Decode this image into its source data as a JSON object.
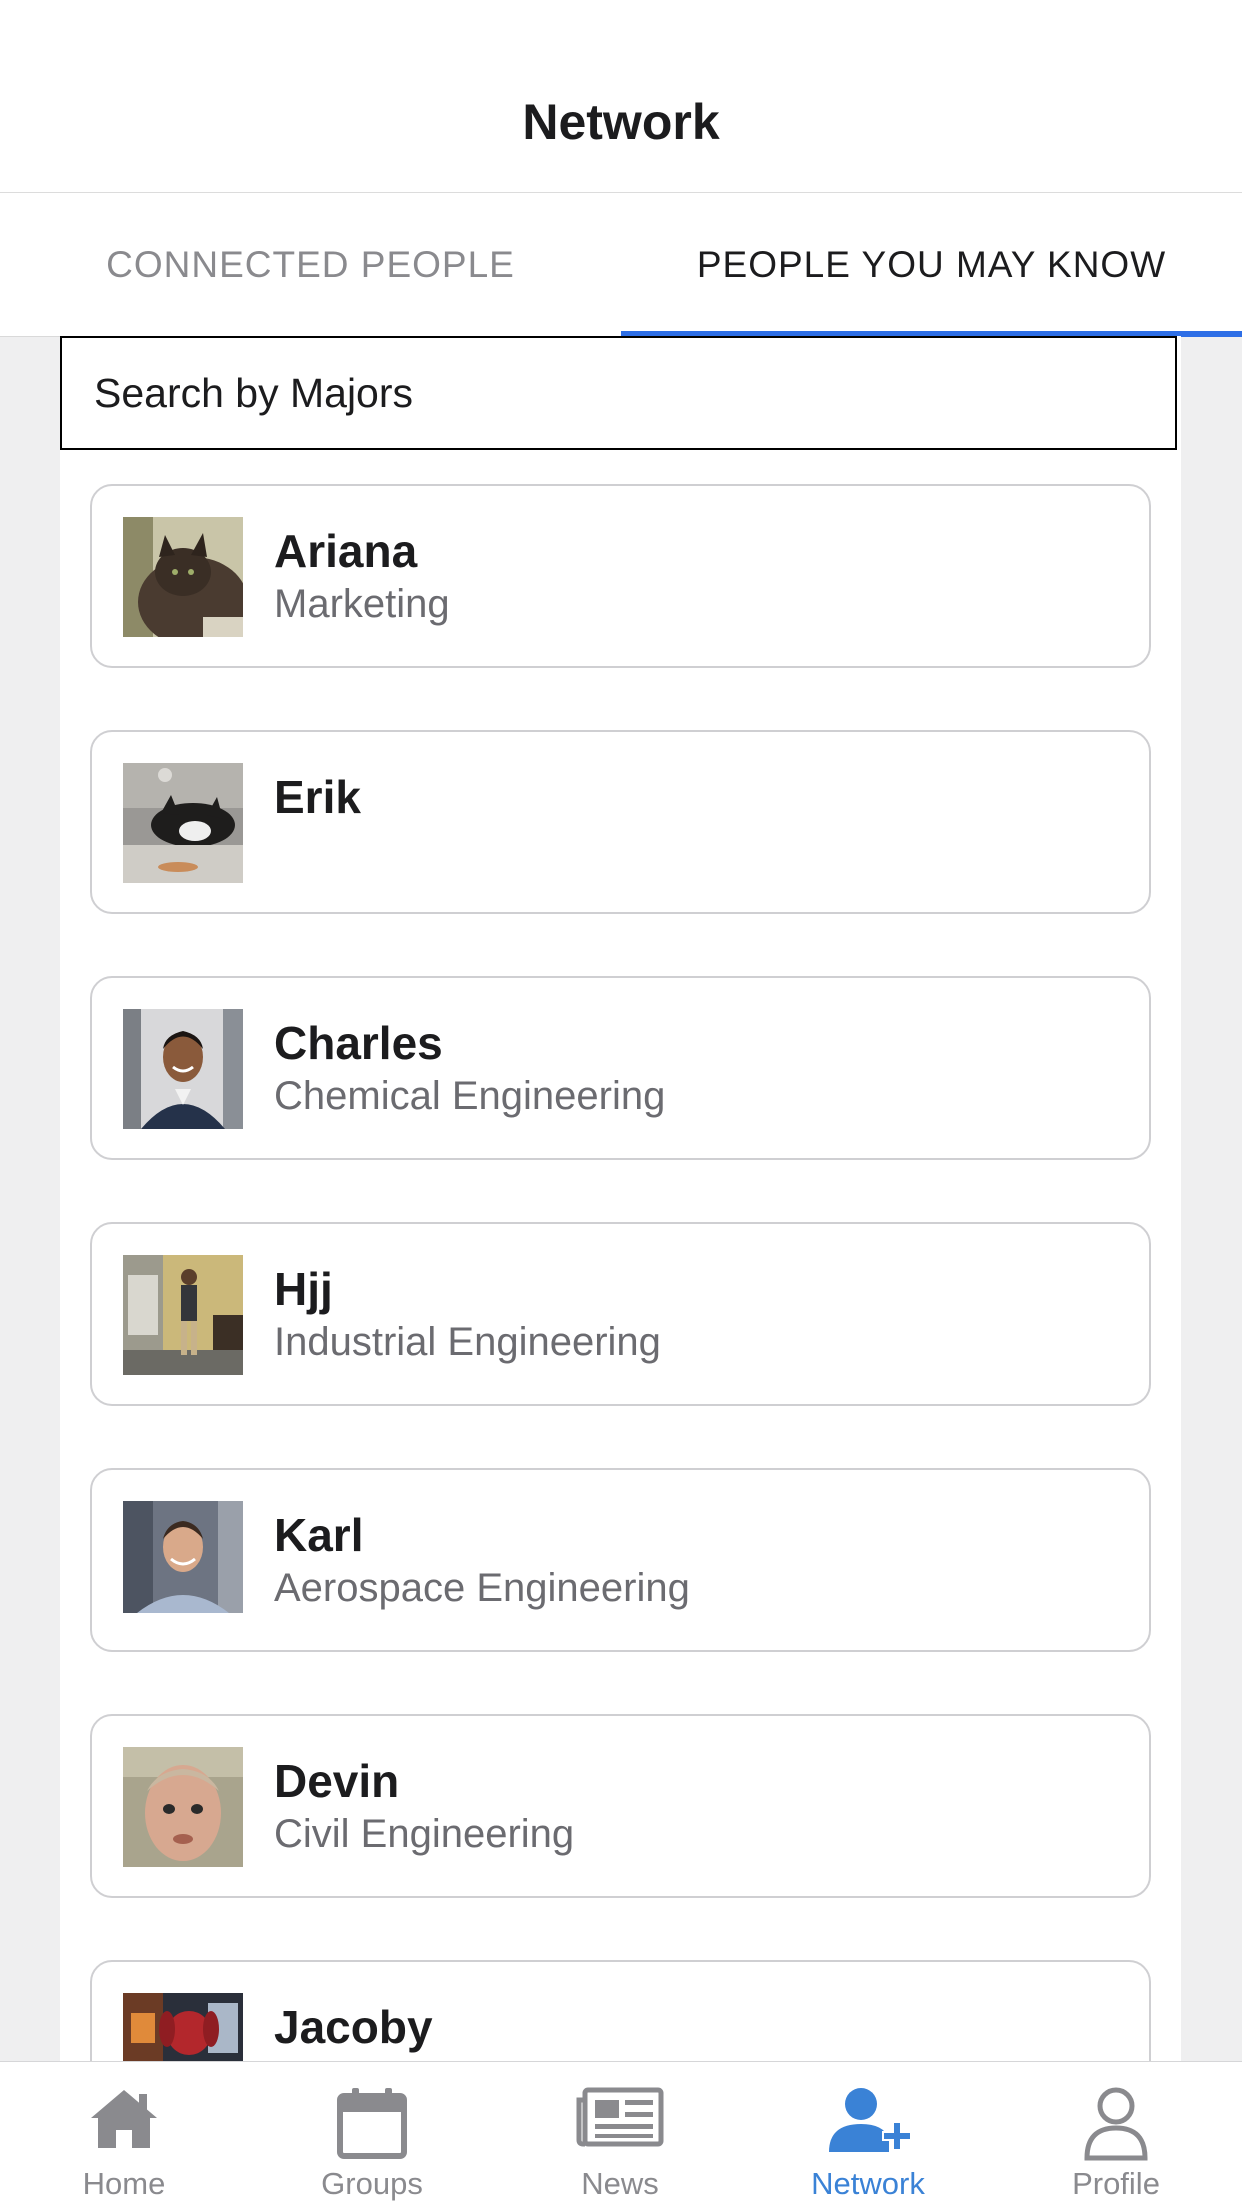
{
  "header": {
    "title": "Network"
  },
  "tabs": [
    {
      "label": "CONNECTED PEOPLE",
      "active": false
    },
    {
      "label": "PEOPLE YOU MAY KNOW",
      "active": true
    }
  ],
  "search": {
    "placeholder": "Search by Majors"
  },
  "people": [
    {
      "name": "Ariana",
      "major": "Marketing"
    },
    {
      "name": "Erik",
      "major": ""
    },
    {
      "name": "Charles",
      "major": "Chemical Engineering"
    },
    {
      "name": "Hjj",
      "major": "Industrial Engineering"
    },
    {
      "name": "Karl",
      "major": "Aerospace Engineering"
    },
    {
      "name": "Devin",
      "major": "Civil Engineering"
    },
    {
      "name": "Jacoby",
      "major": ""
    }
  ],
  "bottom_nav": [
    {
      "label": "Home",
      "icon": "home-icon"
    },
    {
      "label": "Groups",
      "icon": "calendar-icon"
    },
    {
      "label": "News",
      "icon": "newspaper-icon"
    },
    {
      "label": "Network",
      "icon": "add-person-icon",
      "active": true
    },
    {
      "label": "Profile",
      "icon": "person-outline-icon"
    }
  ],
  "colors": {
    "accent": "#2d6ee6",
    "nav_active": "#3a82d6",
    "nav_inactive": "#8a8a8e"
  }
}
